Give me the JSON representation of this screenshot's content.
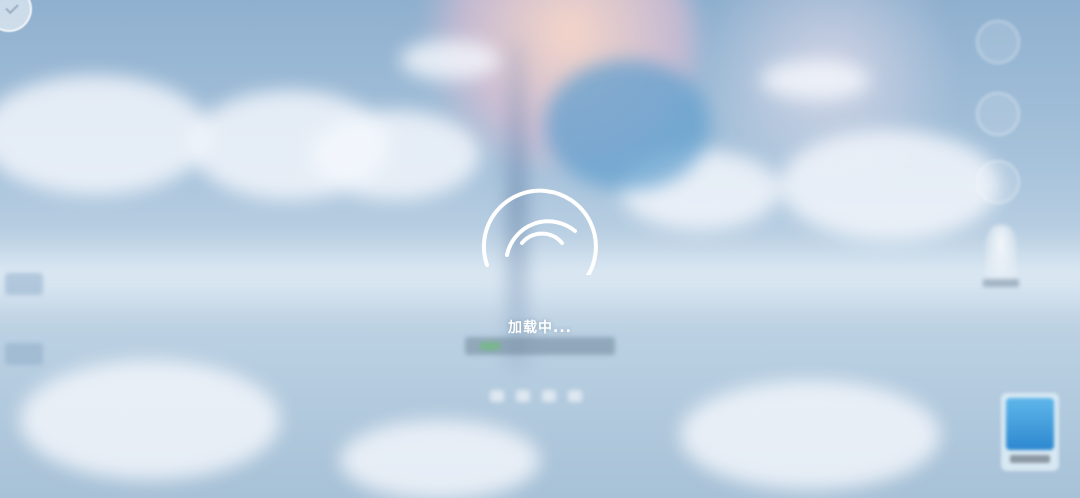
{
  "loading": {
    "text": "加载中..."
  },
  "icons": {
    "spinner": "wifi-arc-spinner",
    "corner": "check-icon",
    "side_buttons": [
      "rotate-icon",
      "globe-icon",
      "settings-icon"
    ]
  },
  "colors": {
    "spinner": "#ffffff",
    "text": "#ffffff",
    "sky": "#a9c4dc",
    "event_card": "#3f9ddc"
  }
}
